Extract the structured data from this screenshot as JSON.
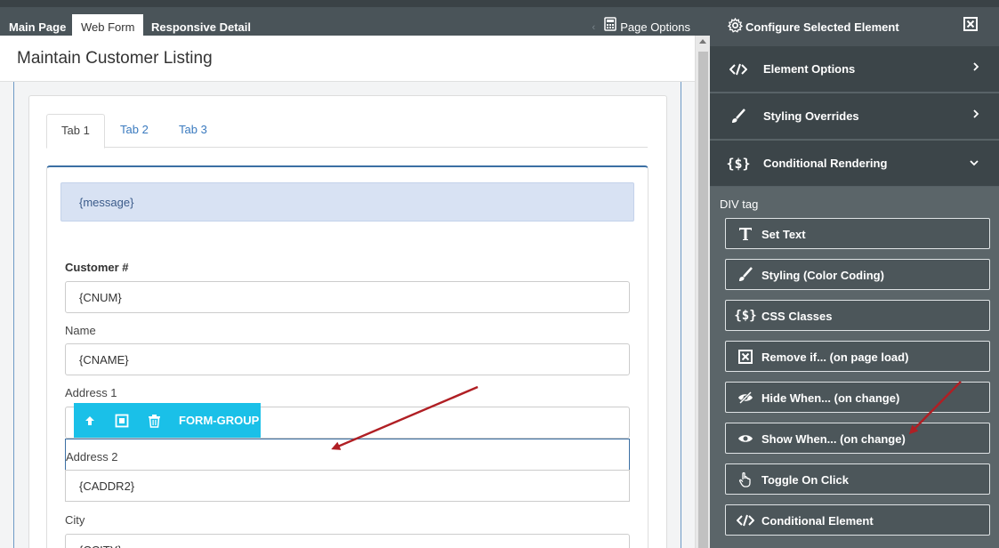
{
  "top_tabs": [
    "Main Page",
    "Web Form",
    "Responsive Detail"
  ],
  "page_options_label": "Page Options",
  "page_title": "Maintain Customer Listing",
  "form_tabs": [
    "Tab 1",
    "Tab 2",
    "Tab 3"
  ],
  "message_placeholder": "{message}",
  "fields": [
    {
      "label": "Customer #",
      "value": "{CNUM}"
    },
    {
      "label": "Name",
      "value": "{CNAME}"
    },
    {
      "label": "Address 1",
      "value": ""
    },
    {
      "label": "Address 2",
      "value": "{CADDR2}"
    },
    {
      "label": "City",
      "value": "{CCITY}"
    }
  ],
  "form_group_toolbar": {
    "label": "FORM-GROUP",
    "icons": [
      "move-up-icon",
      "select-parent-icon",
      "delete-icon"
    ]
  },
  "side_panel": {
    "title": "Configure Selected Element",
    "sections": [
      {
        "label": "Element Options",
        "icon": "code-icon",
        "state": "collapsed"
      },
      {
        "label": "Styling Overrides",
        "icon": "brush-icon",
        "state": "collapsed"
      },
      {
        "label": "Conditional Rendering",
        "icon": "braces-icon",
        "state": "expanded"
      }
    ],
    "tag_label": "DIV tag",
    "options": [
      {
        "label": "Set Text",
        "icon": "text-icon"
      },
      {
        "label": "Styling (Color Coding)",
        "icon": "brush-icon"
      },
      {
        "label": "CSS Classes",
        "icon": "braces-icon"
      },
      {
        "label": "Remove if... (on page load)",
        "icon": "remove-icon"
      },
      {
        "label": "Hide When... (on change)",
        "icon": "eye-slash-icon"
      },
      {
        "label": "Show When... (on change)",
        "icon": "eye-icon"
      },
      {
        "label": "Toggle On Click",
        "icon": "pointer-icon"
      },
      {
        "label": "Conditional Element",
        "icon": "code-icon"
      }
    ]
  },
  "colors": {
    "accent": "#1ac0e8",
    "sidebar": "#5b6569",
    "arrow": "#b01f24"
  }
}
